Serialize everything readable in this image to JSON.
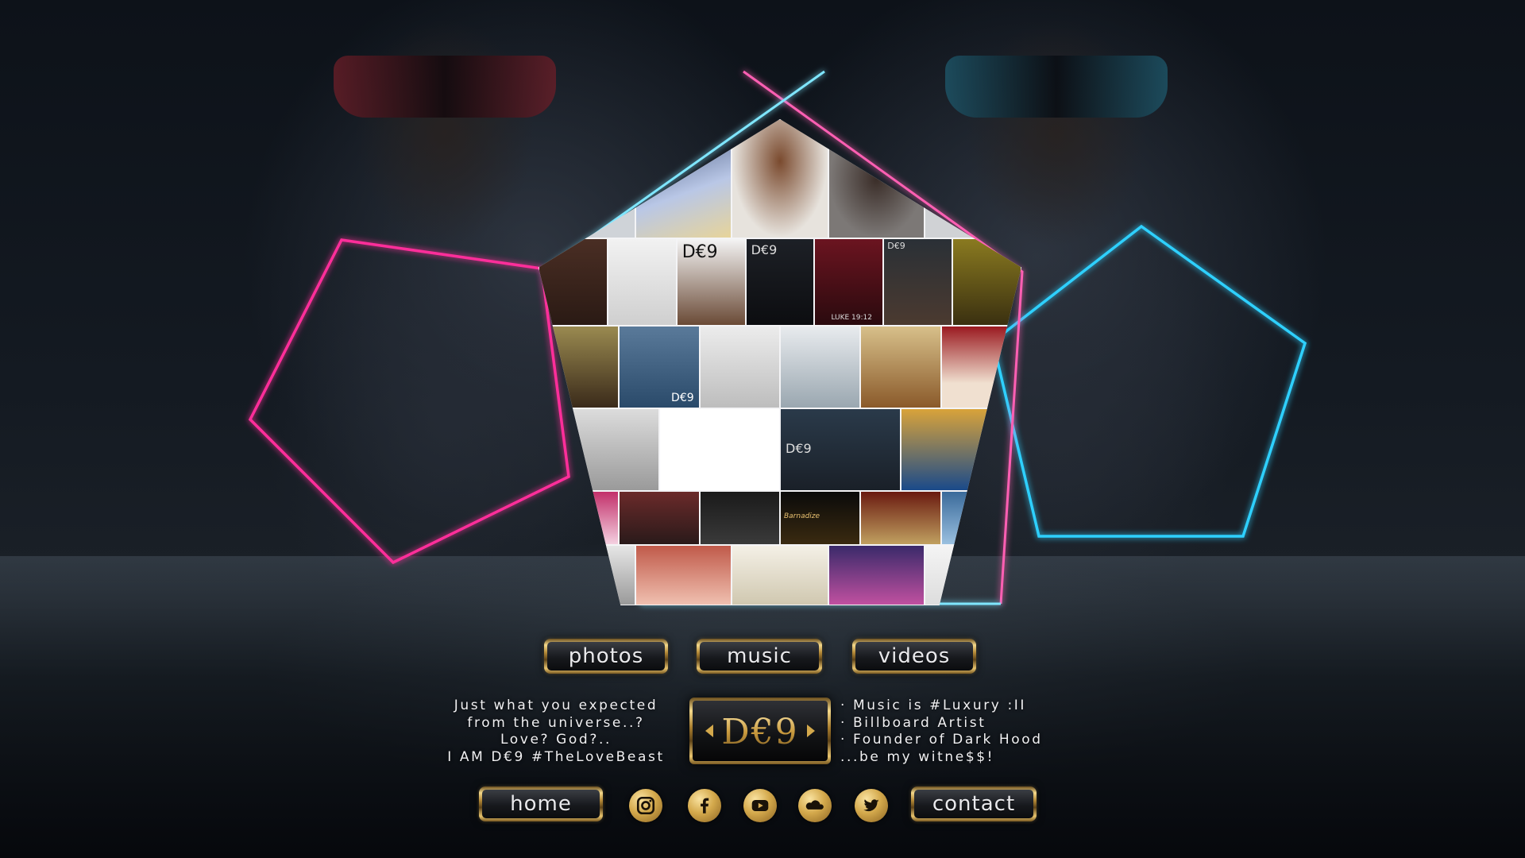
{
  "nav": {
    "photos_label": "photos",
    "music_label": "music",
    "videos_label": "videos",
    "home_label": "home",
    "contact_label": "contact"
  },
  "tagline_left": [
    "Just what you expected",
    "from the universe..?",
    "Love? God?..",
    "I AM D€9 #TheLoveBeast"
  ],
  "tagline_right": [
    "· Music is #Luxury :II",
    "· Billboard Artist",
    "· Founder of Dark Hood",
    "...be my witne$$!"
  ],
  "logo": {
    "text": "D€9"
  },
  "collage_tiles": {
    "row1_tile3_text": "D€9",
    "row1_tile4_text": "D€9",
    "row1_tile6_text": "D€9",
    "row1_tile5_caption": "LUKE 19:12",
    "row2_tile2_text": "D€9",
    "row3_tile3_text": "D€9",
    "row4_tile2_cover_text": "Barnadize"
  },
  "social": [
    {
      "name": "instagram-icon"
    },
    {
      "name": "facebook-icon"
    },
    {
      "name": "youtube-icon"
    },
    {
      "name": "soundcloud-icon"
    },
    {
      "name": "twitter-icon"
    }
  ],
  "colors": {
    "neon_pink": "#ff2e9a",
    "neon_cyan": "#2fd0ff",
    "gold": "#d4a94c",
    "background": "#0b0f15"
  }
}
